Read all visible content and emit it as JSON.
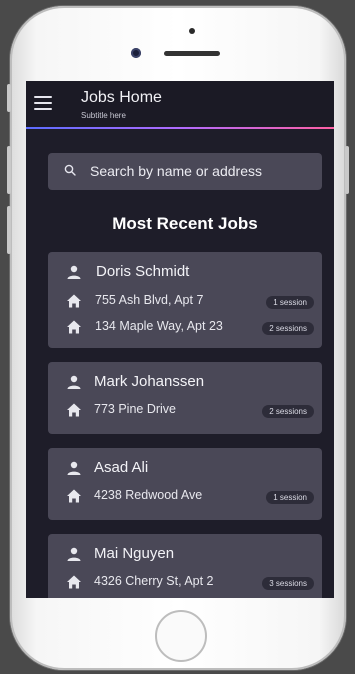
{
  "header": {
    "title": "Jobs Home",
    "subtitle": "Subtitle here",
    "menu_icon": "menu-icon"
  },
  "search": {
    "placeholder": "Search by name or address",
    "icon": "search-icon"
  },
  "section": {
    "title": "Most Recent Jobs"
  },
  "jobs": [
    {
      "name": "Doris Schmidt",
      "addresses": [
        {
          "address": "755 Ash Blvd, Apt 7",
          "sessions": "1 session"
        },
        {
          "address": "134 Maple Way, Apt 23",
          "sessions": "2 sessions"
        }
      ]
    },
    {
      "name": "Mark Johanssen",
      "addresses": [
        {
          "address": "773 Pine Drive",
          "sessions": "2 sessions"
        }
      ]
    },
    {
      "name": "Asad Ali",
      "addresses": [
        {
          "address": "4238 Redwood Ave",
          "sessions": "1 session"
        }
      ]
    },
    {
      "name": "Mai Nguyen",
      "addresses": [
        {
          "address": "4326 Cherry St, Apt 2",
          "sessions": "3 sessions"
        }
      ]
    }
  ],
  "colors": {
    "background": "#1e1d29",
    "card": "#4a4857",
    "badge": "#2d2c39",
    "accent_gradient_start": "#5b6cff",
    "accent_gradient_end": "#ff5fa2"
  }
}
